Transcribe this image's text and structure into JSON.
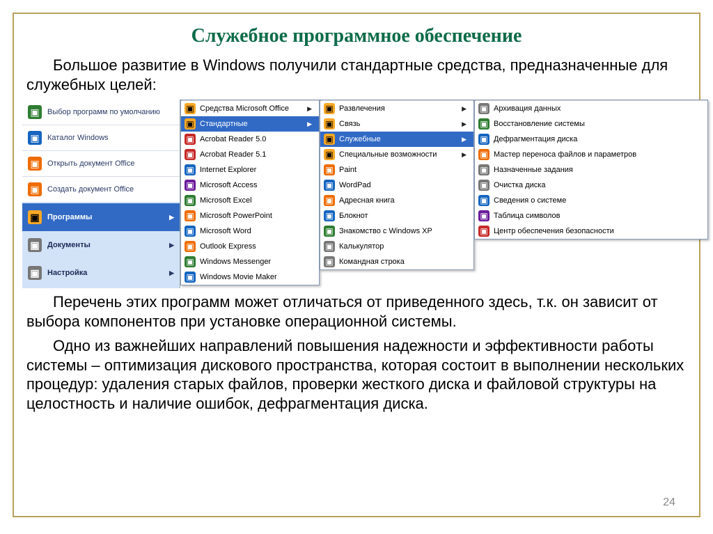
{
  "title": "Служебное программное обеспечение",
  "intro": "Большое развитие в Windows получили стандартные средства, предназначенные для служебных целей:",
  "para2": "Перечень этих программ может отличаться от приведенного здесь, т.к. он зависит от выбора компонентов при установке операционной системы.",
  "para3": "Одно из важнейших направлений повышения надежности и эффективности работы системы – оптимизация дискового пространства, которая состоит в выполнении нескольких процедур: удаления старых файлов, проверки жесткого диска и файловой структуры на целостность и наличие ошибок, дефрагментация диска.",
  "pagenum": "24",
  "start": {
    "top": [
      {
        "label": "Выбор программ по умолчанию"
      },
      {
        "label": "Каталог Windows"
      },
      {
        "label": "Открыть документ Office"
      },
      {
        "label": "Создать документ Office"
      }
    ],
    "blue": [
      {
        "label": "Программы",
        "selected": true
      },
      {
        "label": "Документы"
      },
      {
        "label": "Настройка"
      }
    ]
  },
  "programs": [
    {
      "label": "Средства Microsoft Office",
      "arrow": true
    },
    {
      "label": "Стандартные",
      "arrow": true,
      "hl": true
    },
    {
      "label": "Acrobat Reader 5.0"
    },
    {
      "label": "Acrobat Reader 5.1"
    },
    {
      "label": "Internet Explorer"
    },
    {
      "label": "Microsoft Access"
    },
    {
      "label": "Microsoft Excel"
    },
    {
      "label": "Microsoft PowerPoint"
    },
    {
      "label": "Microsoft Word"
    },
    {
      "label": "Outlook Express"
    },
    {
      "label": "Windows Messenger"
    },
    {
      "label": "Windows Movie Maker"
    }
  ],
  "standard": [
    {
      "label": "Развлечения",
      "arrow": true
    },
    {
      "label": "Связь",
      "arrow": true
    },
    {
      "label": "Служебные",
      "arrow": true,
      "hl": true
    },
    {
      "label": "Специальные возможности",
      "arrow": true
    },
    {
      "label": "Paint"
    },
    {
      "label": "WordPad"
    },
    {
      "label": "Адресная книга"
    },
    {
      "label": "Блокнот"
    },
    {
      "label": "Знакомство с Windows XP"
    },
    {
      "label": "Калькулятор"
    },
    {
      "label": "Командная строка"
    }
  ],
  "tools": [
    {
      "label": "Архивация данных"
    },
    {
      "label": "Восстановление системы"
    },
    {
      "label": "Дефрагментация диска"
    },
    {
      "label": "Мастер переноса файлов и параметров"
    },
    {
      "label": "Назначенные задания"
    },
    {
      "label": "Очистка диска"
    },
    {
      "label": "Сведения о системе"
    },
    {
      "label": "Таблица символов"
    },
    {
      "label": "Центр обеспечения безопасности"
    }
  ],
  "icons": {
    "start_top": [
      "green",
      "blue",
      "orange",
      "orange"
    ],
    "start_blue": [
      "yellow",
      "gray",
      "gray"
    ],
    "programs": [
      "yellow",
      "yellow",
      "red",
      "red",
      "blue",
      "purple",
      "green",
      "orange",
      "blue",
      "orange",
      "green",
      "blue"
    ],
    "standard": [
      "yellow",
      "yellow",
      "yellow",
      "yellow",
      "orange",
      "blue",
      "orange",
      "blue",
      "green",
      "gray",
      "gray"
    ],
    "tools": [
      "gray",
      "green",
      "blue",
      "orange",
      "gray",
      "gray",
      "blue",
      "purple",
      "red"
    ]
  }
}
